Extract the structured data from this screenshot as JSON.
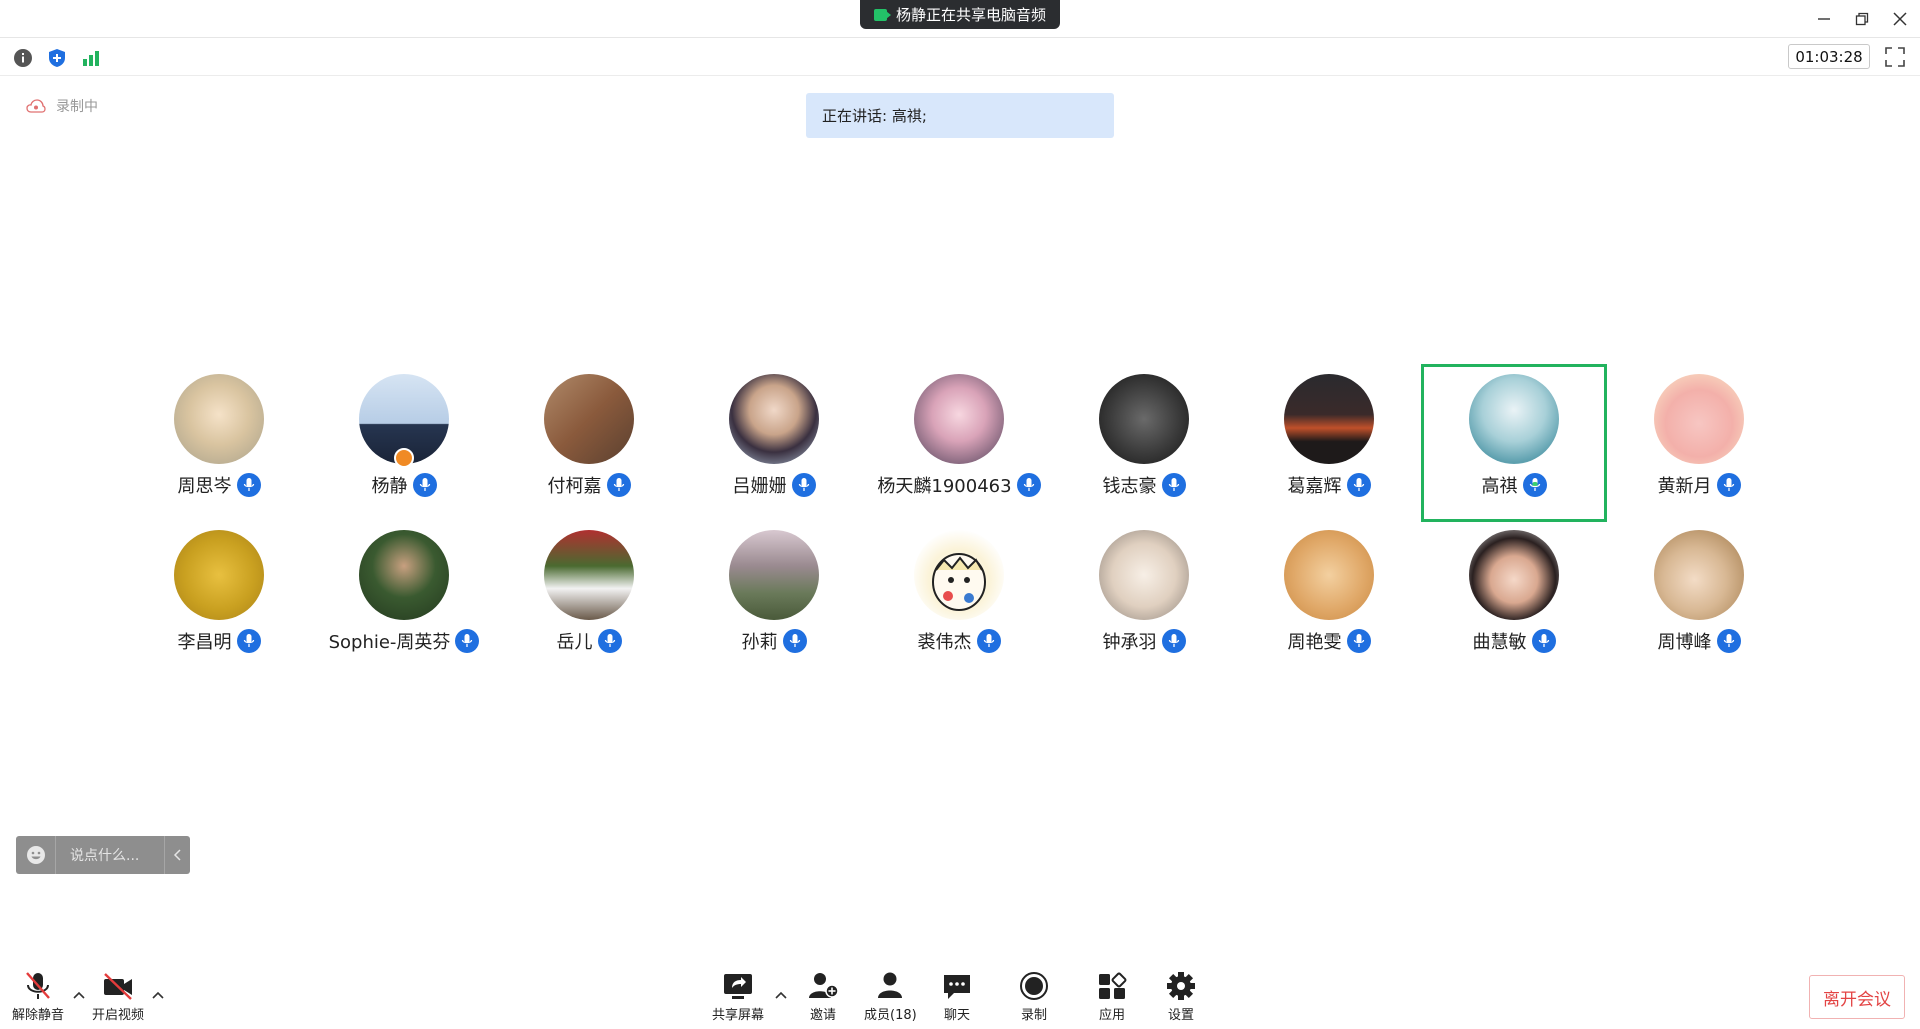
{
  "title_bar": {
    "share_banner": "杨静正在共享电脑音频"
  },
  "info_bar": {
    "timer": "01:03:28"
  },
  "recording_label": "录制中",
  "speaking_label": "正在讲话: 高祺;",
  "participants": [
    {
      "name": "周思岑"
    },
    {
      "name": "杨静"
    },
    {
      "name": "付柯嘉"
    },
    {
      "name": "吕姗姗"
    },
    {
      "name": "杨天麟1900463"
    },
    {
      "name": "钱志豪"
    },
    {
      "name": "葛嘉辉"
    },
    {
      "name": "高祺"
    },
    {
      "name": "黄新月"
    },
    {
      "name": "李昌明"
    },
    {
      "name": "Sophie-周英芬"
    },
    {
      "name": "岳儿"
    },
    {
      "name": "孙莉"
    },
    {
      "name": "裘伟杰"
    },
    {
      "name": "钟承羽"
    },
    {
      "name": "周艳雯"
    },
    {
      "name": "曲慧敏"
    },
    {
      "name": "周博峰"
    }
  ],
  "chat": {
    "placeholder": "说点什么..."
  },
  "toolbar": {
    "unmute": "解除静音",
    "start_video": "开启视频",
    "share_screen": "共享屏幕",
    "invite": "邀请",
    "members": "成员(18)",
    "chat": "聊天",
    "record": "录制",
    "apps": "应用",
    "settings": "设置",
    "leave": "离开会议"
  },
  "colors": {
    "active_speaker_border": "#22b35e",
    "mic_badge": "#1f6fe0",
    "leave_text": "#e34444",
    "speaking_bg": "#d8e7fb"
  }
}
